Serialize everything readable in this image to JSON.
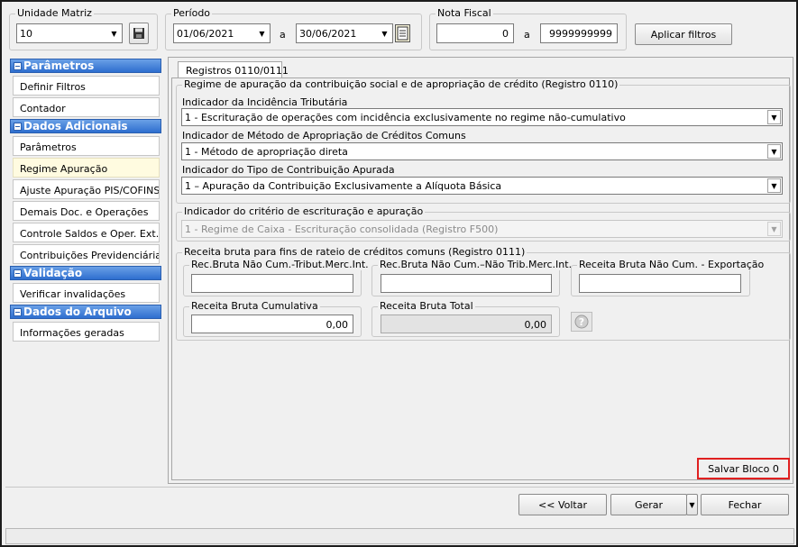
{
  "filters": {
    "unidade_label": "Unidade Matriz",
    "unidade_value": "10",
    "periodo_label": "Período",
    "periodo_start": "01/06/2021",
    "periodo_end": "30/06/2021",
    "a1": "a",
    "nota_label": "Nota Fiscal",
    "nota_start": "0",
    "nota_end": "9999999999",
    "a2": "a",
    "apply_label": "Aplicar filtros"
  },
  "sidebar": {
    "sections": [
      {
        "title": "Parâmetros",
        "items": [
          "Definir Filtros",
          "Contador"
        ]
      },
      {
        "title": "Dados Adicionais",
        "items": [
          "Parâmetros",
          "Regime Apuração",
          "Ajuste Apuração PIS/COFINS",
          "Demais Doc. e Operações",
          "Controle Saldos e Oper. Ext.",
          "Contribuições Previdenciárias"
        ]
      },
      {
        "title": "Validação",
        "items": [
          "Verificar invalidações"
        ]
      },
      {
        "title": "Dados do Arquivo",
        "items": [
          "Informações geradas"
        ]
      }
    ],
    "active_item": "Regime Apuração"
  },
  "main": {
    "tab_label": "Registros 0110/0111",
    "group1_title": "Regime de apuração da contribuição social e de apropriação de crédito (Registro 0110)",
    "incidencia_label": "Indicador da Incidência Tributária",
    "incidencia_value": "1 - Escrituração de operações com incidência exclusivamente no regime não-cumulativo",
    "metodo_label": "Indicador de Método de Apropriação de Créditos Comuns",
    "metodo_value": "1 - Método de apropriação direta",
    "tipo_label": "Indicador do Tipo de Contribuição Apurada",
    "tipo_value": "1 – Apuração da Contribuição Exclusivamente a Alíquota Básica",
    "group2_title": "Indicador do critério de escrituração e apuração",
    "criterio_value": "1 - Regime de Caixa - Escrituração consolidada (Registro F500)",
    "group3_title": "Receita bruta para fins de rateio de créditos comuns (Registro 0111)",
    "rec_trib_label": "Rec.Bruta Não Cum.-Tribut.Merc.Int.",
    "rec_trib_value": "",
    "rec_nao_trib_label": "Rec.Bruta Não Cum.–Não Trib.Merc.Int.",
    "rec_nao_trib_value": "",
    "rec_export_label": "Receita Bruta Não Cum. - Exportação",
    "rec_export_value": "",
    "rec_cumul_label": "Receita Bruta Cumulativa",
    "rec_cumul_value": "0,00",
    "rec_total_label": "Receita Bruta Total",
    "rec_total_value": "0,00",
    "help_icon": "help-icon",
    "save_block_label": "Salvar Bloco 0",
    "highlight_color": "#e02020"
  },
  "footer": {
    "back_label": "<< Voltar",
    "generate_label": "Gerar",
    "close_label": "Fechar"
  }
}
